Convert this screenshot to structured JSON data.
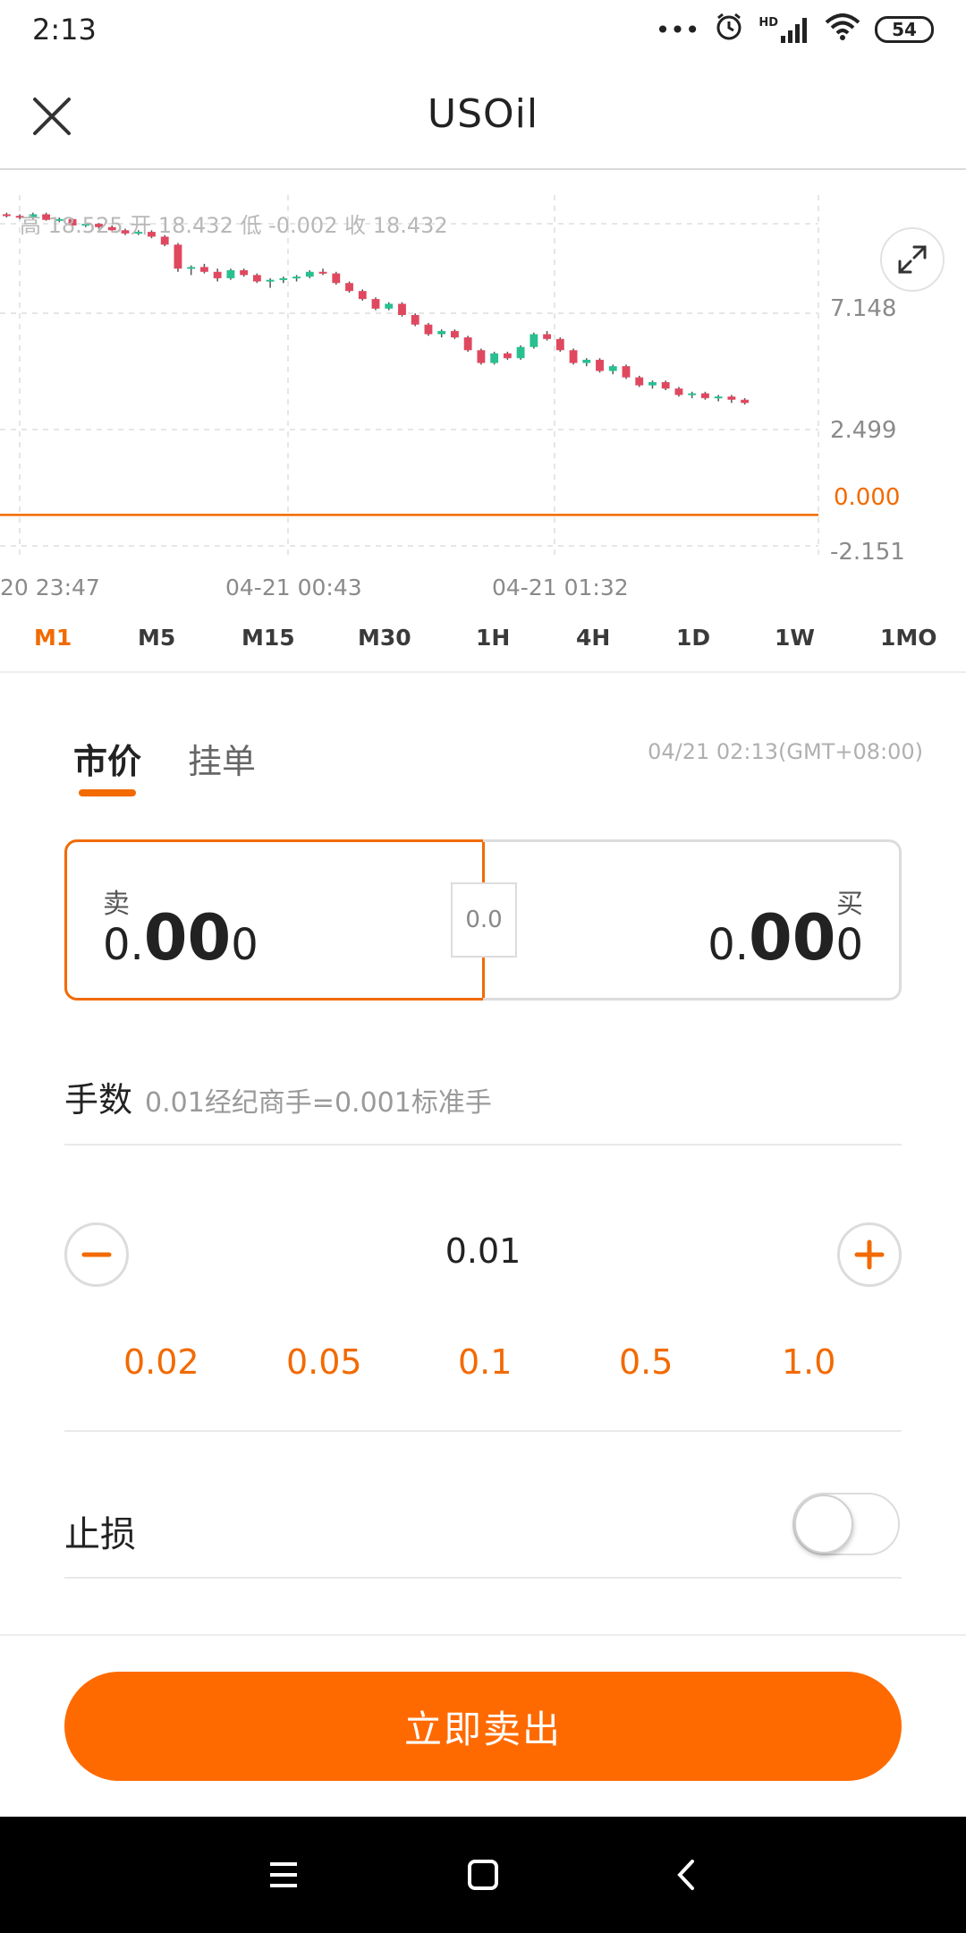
{
  "status_bar": {
    "time": "2:13",
    "dots": "•••",
    "hd": "HD",
    "battery": "54"
  },
  "header": {
    "title": "USOil"
  },
  "chart_data": {
    "type": "candlestick",
    "ohlc_text": "高 18.525  开 18.432  低 -0.002  收 18.432",
    "y_tick_labels": [
      "7.148",
      "2.499",
      "0.000",
      "-2.151"
    ],
    "y_ticks": [
      7.148,
      2.499,
      0.0,
      -2.151
    ],
    "current_price_line": 0.0,
    "x_tick_labels": [
      "20 23:47",
      "04-21 00:43",
      "04-21 01:32"
    ],
    "grid": true,
    "colors": {
      "up": "#28c090",
      "down": "#e04860",
      "price_line": "#f26a00",
      "grid": "#e6e6e6"
    },
    "series": [
      {
        "values": [
          [
            18.8,
            18.9,
            18.6,
            18.7
          ],
          [
            18.7,
            18.8,
            18.5,
            18.6
          ],
          [
            18.6,
            18.9,
            18.5,
            18.8
          ],
          [
            18.8,
            18.9,
            18.4,
            18.45
          ],
          [
            18.45,
            18.6,
            18.3,
            18.5
          ],
          [
            18.5,
            18.55,
            18.0,
            18.1
          ],
          [
            18.1,
            18.3,
            18.0,
            18.2
          ],
          [
            18.2,
            18.25,
            17.9,
            18.0
          ],
          [
            18.0,
            18.1,
            17.7,
            17.8
          ],
          [
            17.8,
            17.9,
            17.5,
            17.6
          ],
          [
            17.6,
            17.8,
            17.5,
            17.7
          ],
          [
            17.7,
            17.8,
            17.3,
            17.4
          ],
          [
            17.4,
            17.5,
            16.8,
            16.9
          ],
          [
            16.9,
            17.0,
            15.2,
            15.4
          ],
          [
            15.4,
            15.6,
            15.0,
            15.5
          ],
          [
            15.5,
            15.7,
            15.1,
            15.2
          ],
          [
            15.2,
            15.4,
            14.6,
            14.8
          ],
          [
            14.8,
            15.4,
            14.7,
            15.3
          ],
          [
            15.3,
            15.4,
            14.9,
            15.0
          ],
          [
            15.0,
            15.1,
            14.5,
            14.6
          ],
          [
            14.6,
            14.8,
            14.2,
            14.7
          ],
          [
            14.7,
            14.9,
            14.5,
            14.8
          ],
          [
            14.8,
            15.0,
            14.6,
            14.9
          ],
          [
            14.9,
            15.3,
            14.8,
            15.2
          ],
          [
            15.2,
            15.4,
            15.0,
            15.1
          ],
          [
            15.1,
            15.2,
            14.4,
            14.5
          ],
          [
            14.5,
            14.6,
            13.9,
            14.0
          ],
          [
            14.0,
            14.1,
            13.4,
            13.5
          ],
          [
            13.5,
            13.6,
            12.8,
            12.9
          ],
          [
            12.9,
            13.3,
            12.8,
            13.2
          ],
          [
            13.2,
            13.3,
            12.4,
            12.5
          ],
          [
            12.5,
            12.6,
            11.8,
            11.9
          ],
          [
            11.9,
            12.0,
            11.2,
            11.3
          ],
          [
            11.3,
            11.6,
            11.1,
            11.5
          ],
          [
            11.5,
            11.6,
            11.0,
            11.1
          ],
          [
            11.1,
            11.2,
            10.2,
            10.3
          ],
          [
            10.3,
            10.4,
            9.4,
            9.5
          ],
          [
            9.5,
            10.2,
            9.4,
            10.1
          ],
          [
            10.1,
            10.2,
            9.7,
            9.8
          ],
          [
            9.8,
            10.6,
            9.7,
            10.5
          ],
          [
            10.5,
            11.4,
            10.4,
            11.3
          ],
          [
            11.3,
            11.5,
            10.9,
            11.0
          ],
          [
            11.0,
            11.1,
            10.2,
            10.3
          ],
          [
            10.3,
            10.4,
            9.4,
            9.5
          ],
          [
            9.5,
            9.8,
            9.3,
            9.7
          ],
          [
            9.7,
            9.8,
            8.9,
            9.0
          ],
          [
            9.0,
            9.4,
            8.8,
            9.3
          ],
          [
            9.3,
            9.4,
            8.5,
            8.6
          ],
          [
            8.6,
            8.7,
            8.0,
            8.1
          ],
          [
            8.1,
            8.4,
            7.9,
            8.3
          ],
          [
            8.3,
            8.4,
            7.8,
            7.9
          ],
          [
            7.9,
            8.0,
            7.4,
            7.5
          ],
          [
            7.5,
            7.7,
            7.3,
            7.6
          ],
          [
            7.6,
            7.7,
            7.2,
            7.3
          ],
          [
            7.3,
            7.5,
            7.1,
            7.4
          ],
          [
            7.4,
            7.5,
            7.0,
            7.2
          ],
          [
            7.2,
            7.3,
            6.9,
            7.0
          ]
        ]
      }
    ]
  },
  "chart": {
    "timeframes": [
      "M1",
      "M5",
      "M15",
      "M30",
      "1H",
      "4H",
      "1D",
      "1W",
      "1MO"
    ],
    "active_timeframe": "M1"
  },
  "order": {
    "tab_market": "市价",
    "tab_pending": "挂单",
    "timestamp": "04/21 02:13(GMT+08:00)",
    "sell_label": "卖",
    "buy_label": "买",
    "sell_price_pre": "0.",
    "sell_price_big": "00",
    "sell_price_post": "0",
    "buy_price_pre": "0.",
    "buy_price_big": "00",
    "buy_price_post": "0",
    "spread": "0.0",
    "lots_title": "手数",
    "lots_hint": "0.01经纪商手=0.001标准手",
    "lot_value": "0.01",
    "presets": [
      "0.02",
      "0.05",
      "0.1",
      "0.5",
      "1.0"
    ],
    "stop_loss_label": "止损",
    "stop_loss_enabled": false,
    "sell_now_label": "立即卖出",
    "accent_color": "#f26a00"
  }
}
